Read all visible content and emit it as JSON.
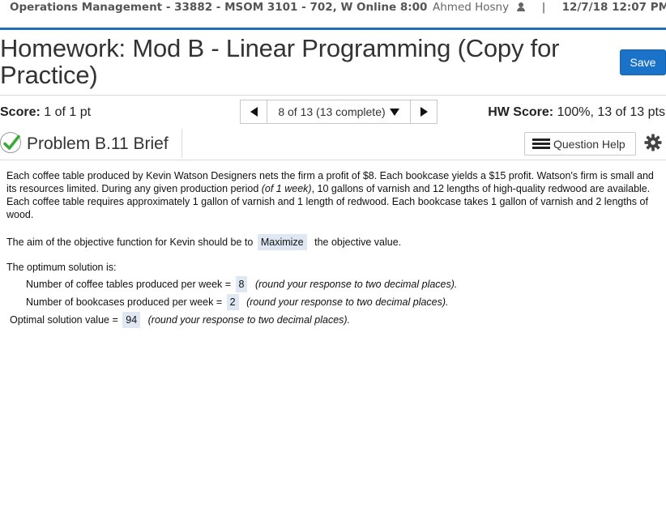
{
  "topbar": {
    "course": "Operations Management - 33882 - MSOM 3101 - 702, W Online 8:00",
    "user": "Ahmed Hosny",
    "separator": "|",
    "datetime": "12/7/18 12:07 PM"
  },
  "header": {
    "title": "Homework: Mod B - Linear Programming (Copy for Practice)",
    "save_label": "Save"
  },
  "score_bar": {
    "score_label": "Score:",
    "score_value": "1 of 1 pt",
    "question_nav": "8 of 13 (13 complete)",
    "hw_score_label": "HW Score:",
    "hw_score_value": "100%, 13 of 13 pts"
  },
  "problem": {
    "title": "Problem B.11 Brief",
    "help_label": "Question Help",
    "status_color": "#3aa935"
  },
  "body": {
    "p1_before": "Each coffee table produced by Kevin Watson Designers nets the firm a profit of $8. Each bookcase yields a $15 profit. Watson's firm is small and its resources limited. During any given production period ",
    "p1_italic": "(of 1 week)",
    "p1_after": ", 10 gallons of varnish and 12 lengths of high-quality redwood are available. Each coffee table requires approximately 1 gallon of varnish and 1 length of redwood. Each bookcase takes 1 gallon of varnish and 2 lengths of wood.",
    "aim_before": "The aim of the objective function for Kevin should be to",
    "aim_answer": "Maximize",
    "aim_after": "the objective value.",
    "optimum_heading": "The optimum solution is:",
    "coffee_label": "Number of coffee tables produced per week =",
    "coffee_value": "8",
    "bookcase_label": "Number of bookcases produced per week =",
    "bookcase_value": "2",
    "optimal_label": "Optimal solution value =",
    "optimal_value": "94",
    "round_note": "(round your response to two decimal places)."
  }
}
